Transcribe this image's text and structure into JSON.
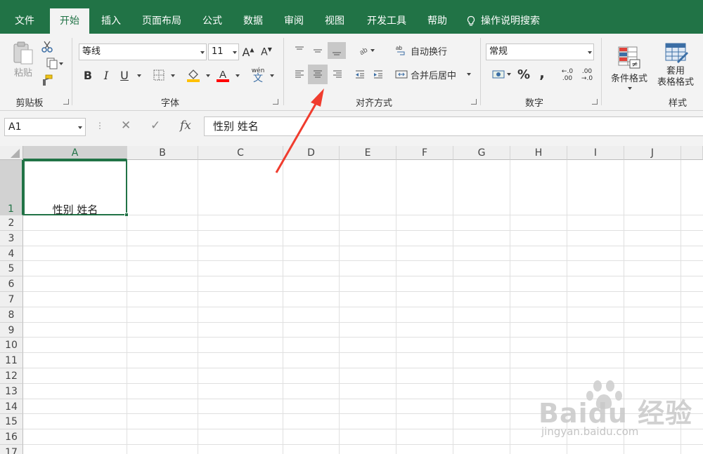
{
  "tabs": [
    {
      "label": "文件",
      "active": false
    },
    {
      "label": "开始",
      "active": true
    },
    {
      "label": "插入",
      "active": false
    },
    {
      "label": "页面布局",
      "active": false
    },
    {
      "label": "公式",
      "active": false
    },
    {
      "label": "数据",
      "active": false
    },
    {
      "label": "审阅",
      "active": false
    },
    {
      "label": "视图",
      "active": false
    },
    {
      "label": "开发工具",
      "active": false
    },
    {
      "label": "帮助",
      "active": false
    }
  ],
  "tell_me": "操作说明搜索",
  "ribbon": {
    "clipboard": {
      "label": "剪贴板",
      "paste_label": "粘贴"
    },
    "font": {
      "label": "字体",
      "font_name": "等线",
      "font_size": "11",
      "bold": "B",
      "italic": "I",
      "underline": "U",
      "phonetic_top": "wén",
      "phonetic_bottom": "文"
    },
    "alignment": {
      "label": "对齐方式",
      "wrap_text": "自动换行",
      "merge_center": "合并后居中",
      "pressed": [
        "align-bottom",
        "align-center"
      ]
    },
    "number": {
      "label": "数字",
      "format": "常规",
      "percent": "%",
      "comma": ",",
      "inc_decimal_top": "←.0",
      "inc_decimal_bottom": ".00",
      "dec_decimal_top": ".00",
      "dec_decimal_bottom": "→.0"
    },
    "styles": {
      "label": "样式",
      "conditional": "条件格式",
      "table_top": "套用",
      "table_bottom": "表格格式"
    }
  },
  "formula_bar": {
    "name_box": "A1",
    "fx": "fx",
    "content": "性别 姓名"
  },
  "columns": [
    "A",
    "B",
    "C",
    "D",
    "E",
    "F",
    "G",
    "H",
    "I",
    "J"
  ],
  "rows": [
    "1",
    "2",
    "3",
    "4",
    "5",
    "6",
    "7",
    "8",
    "9",
    "10",
    "11",
    "12",
    "13",
    "14",
    "15",
    "16",
    "17"
  ],
  "cells": {
    "A1": "性别 姓名"
  },
  "selected_cell": "A1",
  "colors": {
    "accent": "#217346",
    "ribbon_bg": "#f3f3f3",
    "arrow": "#f03c2e",
    "fill_color": "#ffc000",
    "font_color": "#ff0000"
  },
  "watermark": {
    "main": "Baidu 经验",
    "sub": "jingyan.baidu.com"
  }
}
